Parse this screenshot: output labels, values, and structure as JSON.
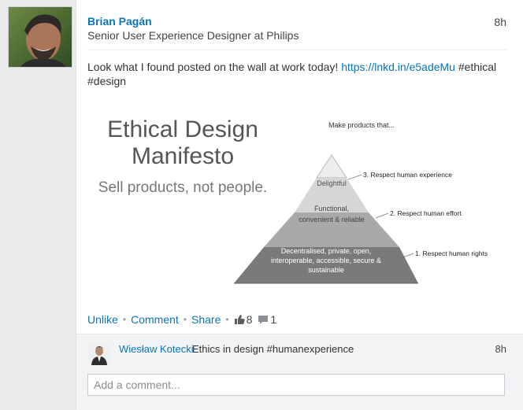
{
  "post": {
    "author_name": "Brian Pagán",
    "author_headline": "Senior User Experience Designer at Philips",
    "time": "8h",
    "text": "Look what I found posted on the wall at work today! ",
    "link": "https://lnkd.in/e5adeMu",
    "tags": " #ethical #design"
  },
  "image": {
    "title_line1": "Ethical Design",
    "title_line2": "Manifesto",
    "subtitle": "Sell products, not people.",
    "caption": "Make products that...",
    "tiers": [
      {
        "label": "Delightful",
        "side": "3.  Respect human experience"
      },
      {
        "label_l1": "Functional,",
        "label_l2": "convenient & reliable",
        "side": "2.  Respect human effort"
      },
      {
        "label_l1": "Decentralised, private, open,",
        "label_l2": "interoperable, accessible, secure &",
        "label_l3": "sustainable",
        "side": "1.  Respect human rights"
      }
    ]
  },
  "actions": {
    "unlike": "Unlike",
    "comment": "Comment",
    "share": "Share",
    "separator": "•",
    "likes": "8",
    "comments": "1"
  },
  "comment": {
    "author": "Wiesław Kotecki",
    "text": "Ethics in design #humanexperience",
    "time": "8h",
    "placeholder": "Add a comment..."
  },
  "colors": {
    "link": "#0a74b5",
    "tier_top": "#d6d6d6",
    "tier_mid": "#a9a9a9",
    "tier_bottom": "#7a7a7a"
  }
}
